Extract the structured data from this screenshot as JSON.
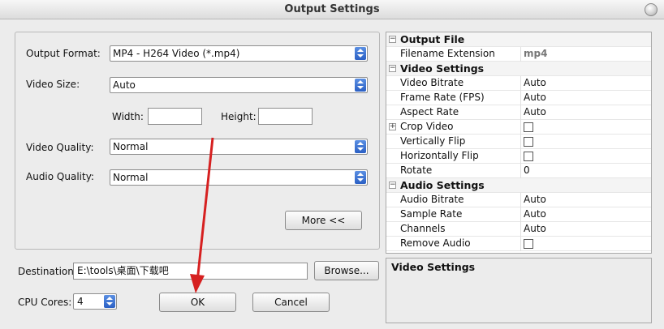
{
  "window": {
    "title": "Output Settings"
  },
  "form": {
    "output_format_label": "Output Format:",
    "output_format_value": "MP4 - H264 Video (*.mp4)",
    "video_size_label": "Video Size:",
    "video_size_value": "Auto",
    "width_label": "Width:",
    "width_value": "",
    "height_label": "Height:",
    "height_value": "",
    "video_quality_label": "Video Quality:",
    "video_quality_value": "Normal",
    "audio_quality_label": "Audio Quality:",
    "audio_quality_value": "Normal",
    "more_button": "More <<"
  },
  "destination": {
    "label": "Destination:",
    "value": "E:\\tools\\桌面\\下载吧",
    "browse_button": "Browse..."
  },
  "cpu": {
    "label": "CPU Cores:",
    "value": "4"
  },
  "actions": {
    "ok": "OK",
    "cancel": "Cancel"
  },
  "properties": {
    "output_file": {
      "title": "Output File",
      "rows": [
        {
          "name": "Filename Extension",
          "value": "mp4"
        }
      ]
    },
    "video_settings": {
      "title": "Video Settings",
      "rows": [
        {
          "name": "Video Bitrate",
          "value": "Auto"
        },
        {
          "name": "Frame Rate (FPS)",
          "value": "Auto"
        },
        {
          "name": "Aspect Rate",
          "value": "Auto"
        },
        {
          "name": "Crop Video"
        },
        {
          "name": "Vertically Flip"
        },
        {
          "name": "Horizontally Flip"
        },
        {
          "name": "Rotate",
          "value": "0"
        }
      ]
    },
    "audio_settings": {
      "title": "Audio Settings",
      "rows": [
        {
          "name": "Audio Bitrate",
          "value": "Auto"
        },
        {
          "name": "Sample Rate",
          "value": "Auto"
        },
        {
          "name": "Channels",
          "value": "Auto"
        },
        {
          "name": "Remove Audio"
        }
      ]
    }
  },
  "description": {
    "title": "Video Settings"
  },
  "colors": {
    "combo_arrow": "#2a5fc4",
    "annotation_arrow": "#d62020"
  }
}
